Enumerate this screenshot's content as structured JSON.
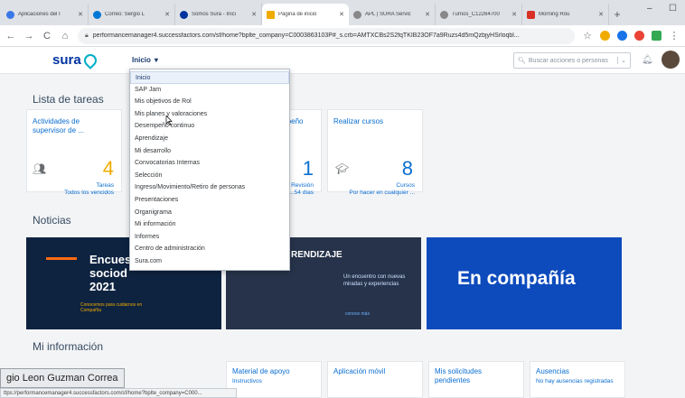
{
  "browser": {
    "tabs": [
      {
        "label": "Aplicaciones del I",
        "color": "#3b78e7"
      },
      {
        "label": "Correo: Sergio L",
        "color": "#0078d4"
      },
      {
        "label": "Somos Sura - Inici",
        "color": "#0033a0"
      },
      {
        "label": "Página de inicio",
        "color": "#f0ab00"
      },
      {
        "label": "APL | SURA Servic",
        "color": "#888888"
      },
      {
        "label": "Turnos_C12264700",
        "color": "#888888"
      },
      {
        "label": "Morning Rou",
        "color": "#d93025"
      }
    ],
    "active_tab_index": 3,
    "new_tab": "+",
    "minimize": "–",
    "maximize": "☐",
    "url": "performancemanager4.successfactors.com/sf/home?bplte_company=C0003863103P#_s.crb=AMTXCBs2S2fqTKIB23OF7a9Ruzs4d5mQzbjyHSrloqbl...",
    "back": "←",
    "forward": "→",
    "reload": "C",
    "home": "⌂",
    "star": "☆"
  },
  "header": {
    "logo_text": "sura",
    "menu_label": "Inicio",
    "menu_caret": "▾",
    "search_placeholder": "Buscar acciones o personas",
    "search_caret": "⌄",
    "bell": "♪"
  },
  "dropdown": {
    "items": [
      "Inicio",
      "SAP Jam",
      "Mis objetivos de Rol",
      "Mis planes y valoraciones",
      "Desempeño continuo",
      "Aprendizaje",
      "Mi desarrollo",
      "Convocatorias Internas",
      "Selección",
      "Ingreso/Movimiento/Retiro de personas",
      "Presentaciones",
      "Organigrama",
      "Mi información",
      "Informes",
      "Centro de administración",
      "Sura.com"
    ],
    "selected_index": 0
  },
  "tasks": {
    "title": "Lista de tareas",
    "cards": [
      {
        "title": "Actividades de supervisor de ...",
        "value": "4",
        "sub": "Tareas",
        "sub2": "Todos los vencidos"
      },
      {
        "title": "...peño",
        "value": "1",
        "sub": "Revisión",
        "sub2": "...54 días"
      },
      {
        "title": "Realizar cursos",
        "value": "8",
        "sub": "Cursos",
        "sub2": "Por hacer en cualquier ..."
      }
    ]
  },
  "news": {
    "title": "Noticias",
    "item1_heading": "Encuesta sociodemográfica 2021",
    "item1_line1": "Encues",
    "item1_line2": "sociod",
    "item1_line3": "2021",
    "item1_note": "Conocemos para cuidarnos en Compañía",
    "item2_heading": "RENDIZAJE",
    "item2_text": "Un encuentro con nuevas miradas y experiencias",
    "item2_link": "conoce más",
    "item3_heading": "En compañía"
  },
  "myinfo": {
    "title": "Mi información",
    "cards": [
      {
        "title": "Material de apoyo",
        "sub": "Instructivos"
      },
      {
        "title": "Aplicación móvil",
        "sub": ""
      },
      {
        "title": "Mis solicitudes pendientes",
        "sub": ""
      },
      {
        "title": "Ausencias",
        "sub": "No hay ausencias registradas"
      }
    ]
  },
  "overlay": {
    "name_tooltip": "gio Leon Guzman Correa",
    "status_url": "ttps://performancemanager4.successfactors.com/sf/home?bplte_company=C000..."
  },
  "colors": {
    "accent": "#0a6ed1",
    "sura_blue": "#0033a0",
    "sura_teal": "#00aec7",
    "orange": "#f0ab00"
  }
}
